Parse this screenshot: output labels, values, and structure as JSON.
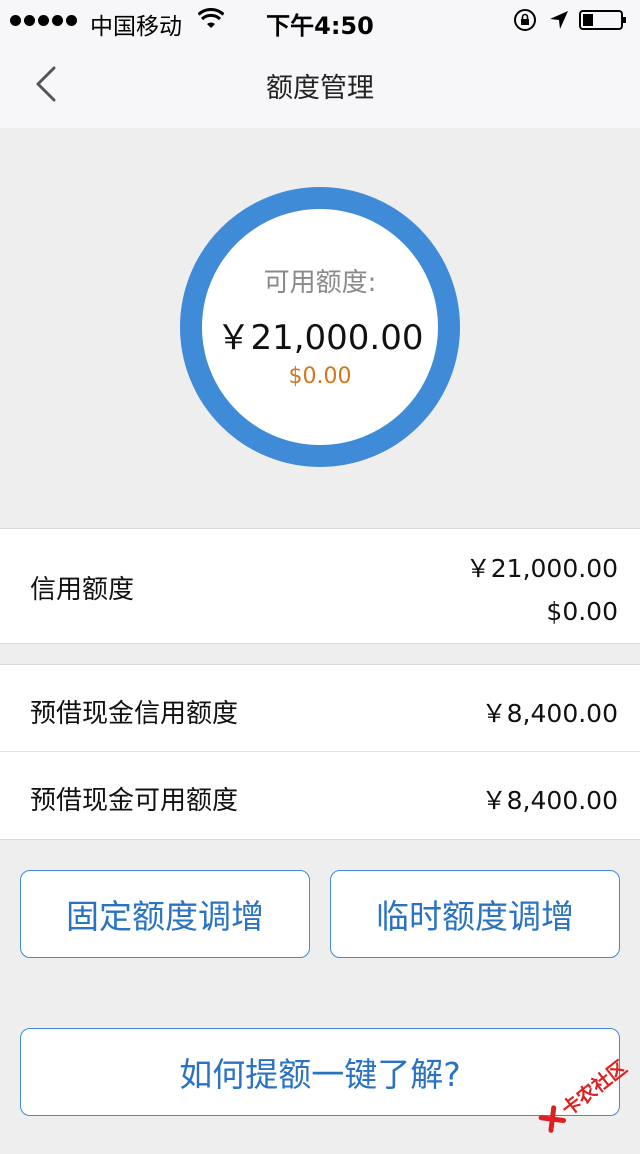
{
  "status_bar": {
    "carrier": "中国移动",
    "time": "下午4:50",
    "icons": [
      "signal-dots",
      "wifi-icon",
      "rotation-lock-icon",
      "location-arrow-icon",
      "battery-icon"
    ]
  },
  "nav": {
    "title": "额度管理",
    "back_icon": "chevron-left-icon"
  },
  "ring": {
    "label": "可用额度:",
    "amount": "￥21,000.00",
    "usd": "$0.00",
    "ring_color": "#3f8bd8",
    "usd_color": "#d4761b"
  },
  "credit": {
    "label": "信用额度",
    "amount_cny": "￥21,000.00",
    "amount_usd": "$0.00"
  },
  "cash": {
    "credit_label": "预借现金信用额度",
    "credit_value": "￥8,400.00",
    "available_label": "预借现金可用额度",
    "available_value": "￥8,400.00"
  },
  "buttons": {
    "fixed": "固定额度调增",
    "temp": "临时额度调增",
    "how": "如何提额一键了解?"
  },
  "watermark": {
    "text": "卡农社区"
  },
  "colors": {
    "accent": "#3f8bd8",
    "button_text": "#2a73c4",
    "background": "#eeeeee"
  }
}
